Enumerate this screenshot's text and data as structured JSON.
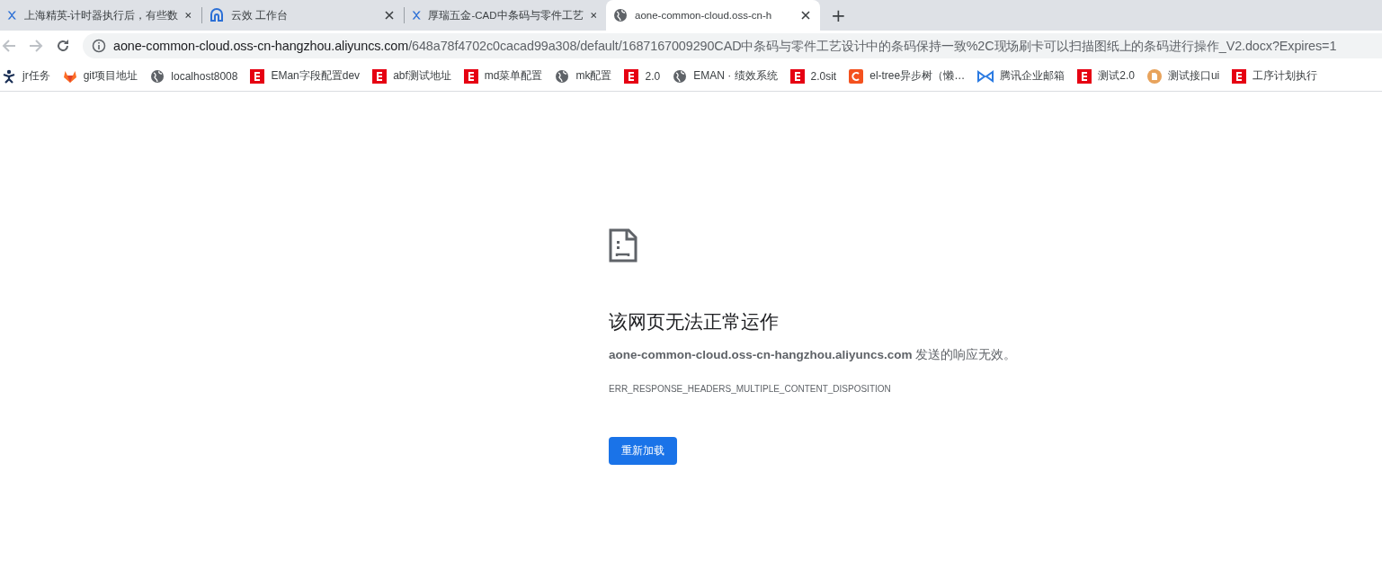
{
  "tabs": [
    {
      "title": "上海精英-计时器执行后，有些数",
      "kind": "x",
      "selected": false
    },
    {
      "title": "云效 工作台",
      "kind": "cloud",
      "selected": false
    },
    {
      "title": "厚瑞五金-CAD中条码与零件工艺",
      "kind": "x",
      "selected": false
    },
    {
      "title": "aone-common-cloud.oss-cn-h",
      "kind": "globe",
      "selected": true
    }
  ],
  "new_tab": "+",
  "address_bar": {
    "host": "aone-common-cloud.oss-cn-hangzhou.aliyuncs.com",
    "path": "/648a78f4702c0cacad99a308/default/1687167009290CAD中条码与零件工艺设计中的条码保持一致%2C现场刷卡可以扫描图纸上的条码进行操作_V2.docx?Expires=1"
  },
  "bookmarks": [
    {
      "label": "jr任务",
      "kind": "figure"
    },
    {
      "label": "git项目地址",
      "kind": "fox"
    },
    {
      "label": "localhost8008",
      "kind": "globe"
    },
    {
      "label": "EMan字段配置dev",
      "kind": "e"
    },
    {
      "label": "abf测试地址",
      "kind": "e"
    },
    {
      "label": "md菜单配置",
      "kind": "e"
    },
    {
      "label": "mk配置",
      "kind": "globe"
    },
    {
      "label": "2.0",
      "kind": "e"
    },
    {
      "label": "EMAN · 绩效系统",
      "kind": "globe"
    },
    {
      "label": "2.0sit",
      "kind": "e"
    },
    {
      "label": "el-tree异步树（懒…",
      "kind": "c"
    },
    {
      "label": "腾讯企业邮箱",
      "kind": "bowtie"
    },
    {
      "label": "测试2.0",
      "kind": "e"
    },
    {
      "label": "测试接口ui",
      "kind": "doc"
    },
    {
      "label": "工序计划执行",
      "kind": "e"
    }
  ],
  "error_page": {
    "heading": "该网页无法正常运作",
    "description": "**aone-common-cloud.oss-cn-hangzhou.aliyuncs.com** 发送的响应无效。",
    "error_code": "ERR_RESPONSE_HEADERS_MULTIPLE_CONTENT_DISPOSITION",
    "reload_button": "重新加载"
  }
}
